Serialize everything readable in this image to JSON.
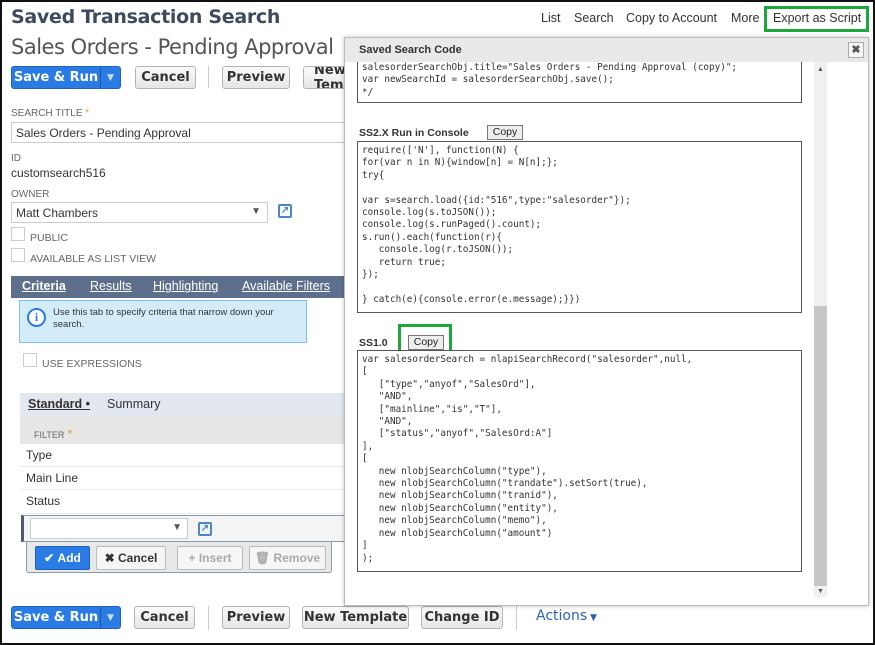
{
  "header": {
    "title": "Saved Transaction Search",
    "subtitle": "Sales Orders - Pending Approval"
  },
  "topnav": {
    "list": "List",
    "search": "Search",
    "copy_to_account": "Copy to Account",
    "more": "More",
    "export": "Export as Script"
  },
  "toolbar": {
    "save_run": "Save & Run",
    "cancel": "Cancel",
    "preview": "Preview",
    "new_template": "New Template",
    "change_id": "Change ID",
    "actions": "Actions"
  },
  "form": {
    "search_title_label": "SEARCH TITLE",
    "search_title_value": "Sales Orders - Pending Approval",
    "id_label": "ID",
    "id_value": "customsearch516",
    "owner_label": "OWNER",
    "owner_value": "Matt Chambers",
    "public_label": "PUBLIC",
    "list_view_label": "AVAILABLE AS LIST VIEW"
  },
  "tabs": [
    {
      "label": "Criteria"
    },
    {
      "label": "Results"
    },
    {
      "label": "Highlighting"
    },
    {
      "label": "Available Filters"
    }
  ],
  "criteria": {
    "info": "Use this tab to specify criteria that narrow down your search.",
    "use_expressions": "USE EXPRESSIONS",
    "subtabs": [
      {
        "label": "Standard •"
      },
      {
        "label": "Summary"
      }
    ],
    "filter_header": "FILTER",
    "rows": [
      "Type",
      "Main Line",
      "Status"
    ],
    "buttons": {
      "add": "Add",
      "cancel": "Cancel",
      "insert": "Insert",
      "remove": "Remove"
    }
  },
  "modal": {
    "title": "Saved Search Code",
    "close": "✖",
    "code_top": "salesorderSearchObj.title=\"Sales Orders - Pending Approval (copy)\";\nvar newSearchId = salesorderSearchObj.save();\n*/",
    "ss2_label": "SS2.X Run in Console",
    "ss2_copy": "Copy",
    "ss2_code": "require(['N'], function(N) {\nfor(var n in N){window[n] = N[n];};\ntry{\n\nvar s=search.load({id:\"516\",type:\"salesorder\"});\nconsole.log(s.toJSON());\nconsole.log(s.runPaged().count);\ns.run().each(function(r){\n   console.log(r.toJSON());\n   return true;\n});\n\n} catch(e){console.error(e.message);}})",
    "ss1_label": "SS1.0",
    "ss1_copy": "Copy",
    "ss1_code": "var salesorderSearch = nlapiSearchRecord(\"salesorder\",null,\n[\n   [\"type\",\"anyof\",\"SalesOrd\"],\n   \"AND\",\n   [\"mainline\",\"is\",\"T\"],\n   \"AND\",\n   [\"status\",\"anyof\",\"SalesOrd:A\"]\n],\n[\n   new nlobjSearchColumn(\"type\"),\n   new nlobjSearchColumn(\"trandate\").setSort(true),\n   new nlobjSearchColumn(\"tranid\"),\n   new nlobjSearchColumn(\"entity\"),\n   new nlobjSearchColumn(\"memo\"),\n   new nlobjSearchColumn(\"amount\")\n]\n);"
  },
  "colors": {
    "highlight": "#1ca83a",
    "primary": "#2a7be4",
    "tabbar": "#5d6f8c"
  }
}
